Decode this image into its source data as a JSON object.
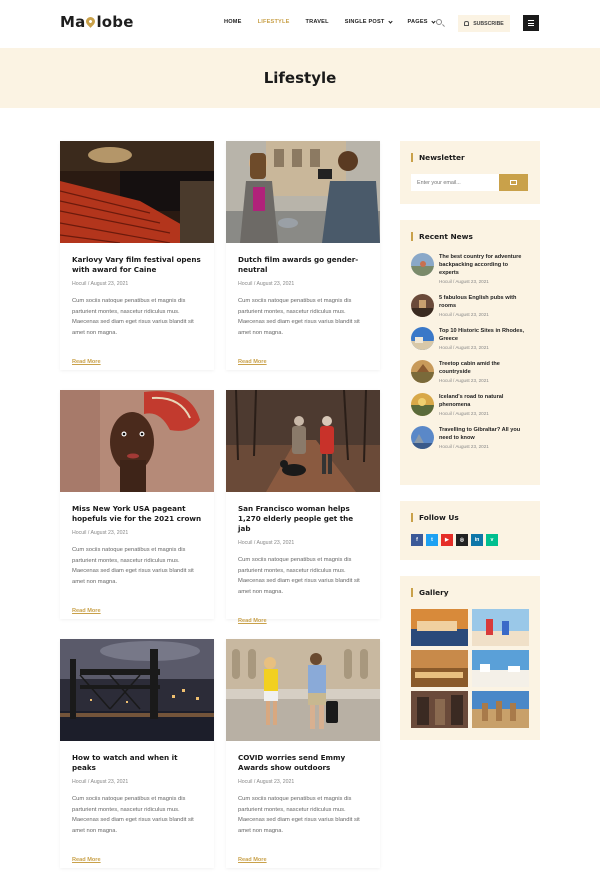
{
  "header": {
    "logo_text_pre": "Ma",
    "logo_text_post": "lobe",
    "nav": [
      "Home",
      "Lifestyle",
      "Travel",
      "Single Post",
      "Pages"
    ],
    "subscribe_label": "Subscribe"
  },
  "banner": {
    "title": "Lifestyle"
  },
  "posts": [
    {
      "title": "Karlovy Vary film festival opens with award for Caine",
      "meta": "Hocuil / August 23, 2021",
      "excerpt": "Cum sociis natoque penatibus et magnis dis parturient montes, nascetur ridiculus mus. Maecenas sed diam eget risus varius blandit sit amet non magna.",
      "readmore": "Read More"
    },
    {
      "title": "Dutch film awards go gender-neutral",
      "meta": "Hocuil / August 23, 2021",
      "excerpt": "Cum sociis natoque penatibus et magnis dis parturient montes, nascetur ridiculus mus. Maecenas sed diam eget risus varius blandit sit amet non magna.",
      "readmore": "Read More"
    },
    {
      "title": "Miss New York USA pageant hopefuls vie for the 2021 crown",
      "meta": "Hocuil / August 23, 2021",
      "excerpt": "Cum sociis natoque penatibus et magnis dis parturient montes, nascetur ridiculus mus. Maecenas sed diam eget risus varius blandit sit amet non magna.",
      "readmore": "Read More"
    },
    {
      "title": "San Francisco woman helps 1,270 elderly people get the jab",
      "meta": "Hocuil / August 23, 2021",
      "excerpt": "Cum sociis natoque penatibus et magnis dis parturient montes, nascetur ridiculus mus. Maecenas sed diam eget risus varius blandit sit amet non magna.",
      "readmore": "Read More"
    },
    {
      "title": "How to watch and when it peaks",
      "meta": "Hocuil / August 23, 2021",
      "excerpt": "Cum sociis natoque penatibus et magnis dis parturient montes, nascetur ridiculus mus. Maecenas sed diam eget risus varius blandit sit amet non magna.",
      "readmore": "Read More"
    },
    {
      "title": "COVID worries send Emmy Awards show outdoors",
      "meta": "Hocuil / August 23, 2021",
      "excerpt": "Cum sociis natoque penatibus et magnis dis parturient montes, nascetur ridiculus mus. Maecenas sed diam eget risus varius blandit sit amet non magna.",
      "readmore": "Read More"
    }
  ],
  "sidebar": {
    "newsletter": {
      "title": "Newsletter",
      "placeholder": "Enter your email..."
    },
    "recent_news": {
      "title": "Recent News",
      "items": [
        {
          "title": "The best country for adventure backpacking according to experts",
          "meta": "Hocuil / August 23, 2021"
        },
        {
          "title": "5 fabulous English pubs with rooms",
          "meta": "Hocuil / August 23, 2021"
        },
        {
          "title": "Top 10 Historic Sites in Rhodes, Greece",
          "meta": "Hocuil / August 23, 2021"
        },
        {
          "title": "Treetop cabin amid the countryside",
          "meta": "Hocuil / August 23, 2021"
        },
        {
          "title": "Iceland's road to natural phenomena",
          "meta": "Hocuil / August 23, 2021"
        },
        {
          "title": "Travelling to Gibraltar? All you need to know",
          "meta": "Hocuil / August 23, 2021"
        }
      ]
    },
    "follow": {
      "title": "Follow Us",
      "networks": [
        {
          "icon": "facebook-icon",
          "glyph": "f",
          "color": "#3b5998"
        },
        {
          "icon": "twitter-icon",
          "glyph": "t",
          "color": "#1da1f2"
        },
        {
          "icon": "youtube-icon",
          "glyph": "▶",
          "color": "#e52d27"
        },
        {
          "icon": "instagram-icon",
          "glyph": "◎",
          "color": "#222222"
        },
        {
          "icon": "linkedin-icon",
          "glyph": "in",
          "color": "#0e76a8"
        },
        {
          "icon": "vine-icon",
          "glyph": "v",
          "color": "#00bf8f"
        }
      ]
    },
    "gallery": {
      "title": "Gallery"
    }
  },
  "colors": {
    "accent": "#c9a14a",
    "cream": "#fbf3e3",
    "dark": "#1a1a1a"
  }
}
